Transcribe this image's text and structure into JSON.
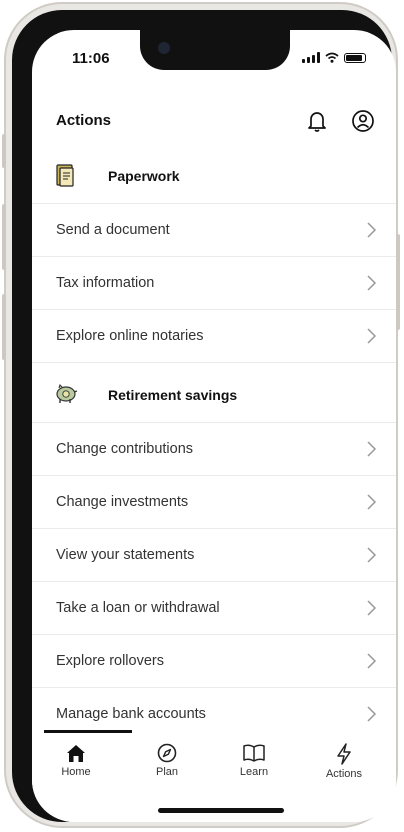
{
  "status_bar": {
    "time": "11:06"
  },
  "header": {
    "title": "Actions",
    "icons": [
      "bell-icon",
      "profile-icon"
    ]
  },
  "sections": [
    {
      "title": "Paperwork",
      "icon": "document-icon",
      "items": [
        {
          "label": "Send a document"
        },
        {
          "label": "Tax information"
        },
        {
          "label": "Explore online notaries"
        }
      ]
    },
    {
      "title": "Retirement savings",
      "icon": "piggy-bank-icon",
      "items": [
        {
          "label": "Change contributions"
        },
        {
          "label": "Change investments"
        },
        {
          "label": "View your statements"
        },
        {
          "label": "Take a loan or withdrawal"
        },
        {
          "label": "Explore rollovers"
        },
        {
          "label": "Manage bank accounts"
        }
      ]
    }
  ],
  "tab_bar": {
    "tabs": [
      {
        "label": "Home",
        "icon": "home-icon",
        "active": true
      },
      {
        "label": "Plan",
        "icon": "compass-icon",
        "active": false
      },
      {
        "label": "Learn",
        "icon": "book-icon",
        "active": false
      },
      {
        "label": "Actions",
        "icon": "lightning-icon",
        "active": false
      }
    ]
  },
  "colors": {
    "text": "#333333",
    "title": "#111111",
    "divider": "#ebebeb",
    "accent_icon": "#c8b45a"
  }
}
